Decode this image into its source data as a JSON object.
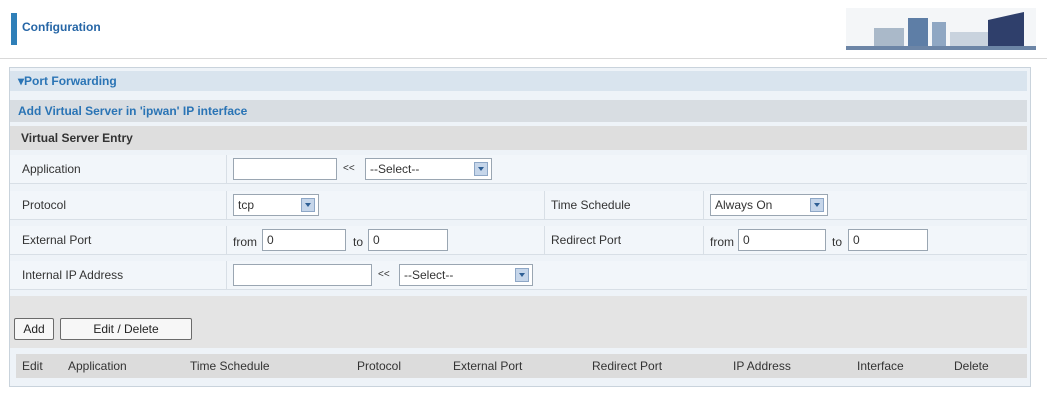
{
  "header": {
    "title": "Configuration"
  },
  "section": {
    "title": "▾Port Forwarding"
  },
  "subsection": {
    "title": "Add Virtual Server in 'ipwan' IP interface"
  },
  "entry": {
    "title": "Virtual Server Entry"
  },
  "form": {
    "application": {
      "label": "Application",
      "value": "",
      "chevron": "<<",
      "select": "--Select--"
    },
    "protocol": {
      "label": "Protocol",
      "value": "tcp"
    },
    "time_schedule": {
      "label": "Time Schedule",
      "value": "Always On"
    },
    "external_port": {
      "label": "External Port",
      "from_label": "from",
      "from_value": "0",
      "to_label": "to",
      "to_value": "0"
    },
    "redirect_port": {
      "label": "Redirect Port",
      "from_label": "from",
      "from_value": "0",
      "to_label": "to",
      "to_value": "0"
    },
    "internal_ip": {
      "label": "Internal IP Address",
      "value": "",
      "chevron": "<<",
      "select": "--Select--"
    }
  },
  "buttons": {
    "add": "Add",
    "edit_delete": "Edit / Delete"
  },
  "table": {
    "columns": [
      "Edit",
      "Application",
      "Time Schedule",
      "Protocol",
      "External Port",
      "Redirect Port",
      "IP Address",
      "Interface",
      "Delete"
    ]
  },
  "colors": {
    "accent": "#2a74b5",
    "header_bar": "#2f7fb8"
  }
}
